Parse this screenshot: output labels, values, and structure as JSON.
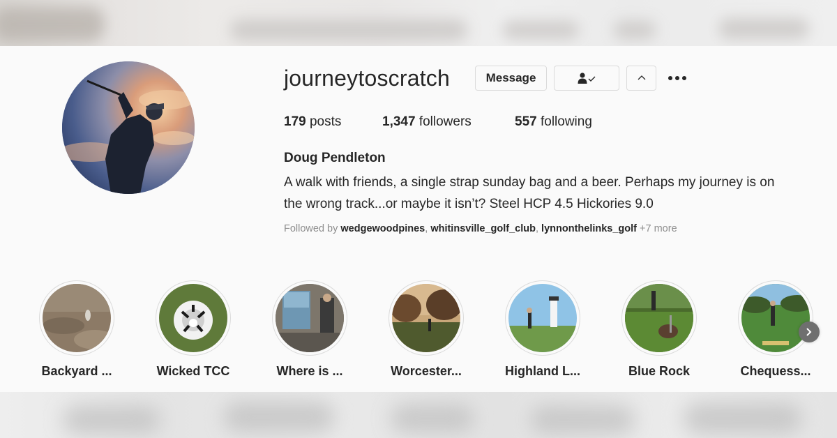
{
  "profile": {
    "username": "journeytoscratch",
    "full_name": "Doug Pendleton",
    "bio_line1": "A walk with friends, a single strap sunday bag and a beer. Perhaps my journey is on",
    "bio_line2": "the wrong track...or maybe it isn’t? Steel HCP 4.5 Hickories 9.0",
    "avatar_icon": "profile-photo-golfer-silhouette"
  },
  "actions": {
    "message_label": "Message",
    "following_icon": "person-check-icon",
    "suggest_icon": "chevron-up-icon",
    "more_icon": "more-options-icon"
  },
  "stats": {
    "posts_count": "179",
    "posts_label": "posts",
    "followers_count": "1,347",
    "followers_label": "followers",
    "following_count": "557",
    "following_label": "following"
  },
  "followed_by": {
    "prefix": "Followed by",
    "users": [
      "wedgewoodpines",
      "whitinsville_golf_club",
      "lynnonthelinks_golf"
    ],
    "more": "+7 more"
  },
  "highlights": [
    {
      "label": "Backyard ..."
    },
    {
      "label": "Wicked TCC"
    },
    {
      "label": "Where is ..."
    },
    {
      "label": "Worcester..."
    },
    {
      "label": "Highland L..."
    },
    {
      "label": "Blue Rock"
    },
    {
      "label": "Chequess..."
    }
  ],
  "highlights_next_icon": "chevron-right-icon",
  "colors": {
    "background": "#fafafa",
    "text": "#262626",
    "muted": "#8e8e8e",
    "border": "#dbdbdb"
  }
}
